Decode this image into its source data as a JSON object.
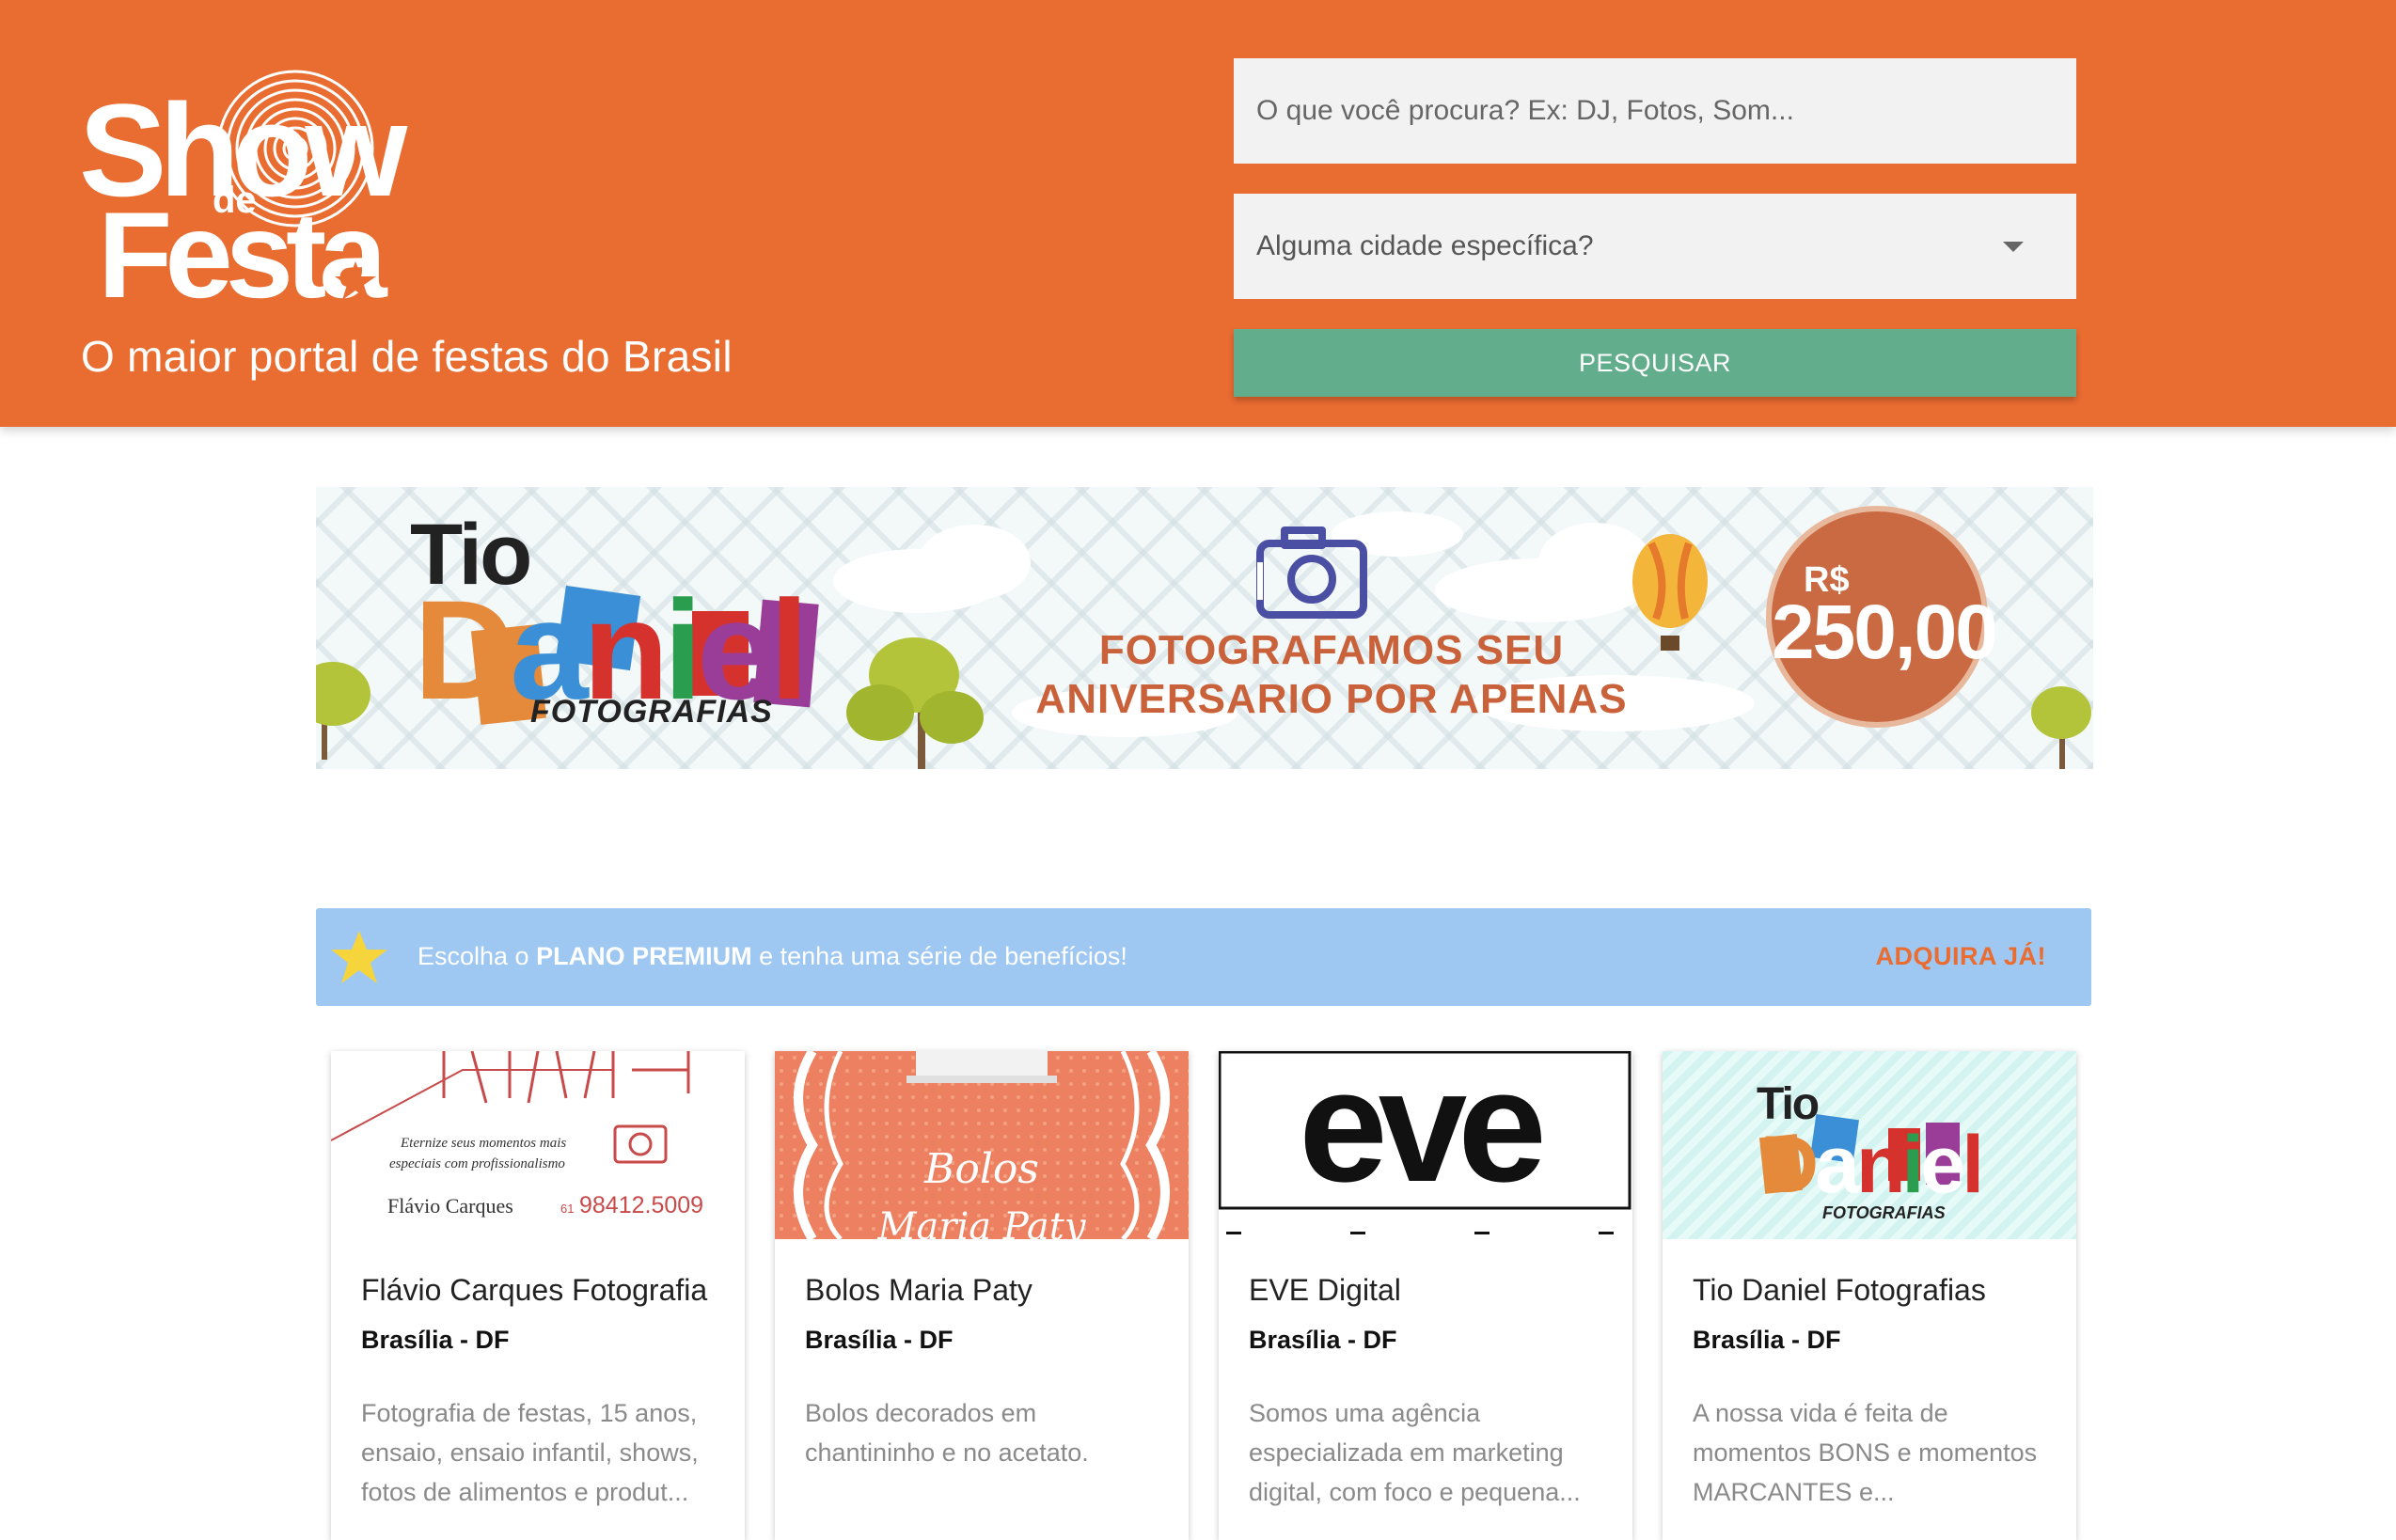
{
  "header": {
    "logo": {
      "line1": "Show",
      "line2": "de",
      "line3": "Festa"
    },
    "tagline": "O maior portal de festas do Brasil",
    "search": {
      "placeholder": "O que você procura? Ex: DJ, Fotos, Som..."
    },
    "city": {
      "placeholder": "Alguma cidade específica?"
    },
    "search_button": "PESQUISAR",
    "colors": {
      "header_bg": "#e96c31",
      "button_bg": "#62ad8b"
    }
  },
  "banner": {
    "brand_top": "Tio",
    "brand_letters": [
      "D",
      "a",
      "n",
      "i",
      "e",
      "l"
    ],
    "brand_sub": "FOTOGRAFIAS",
    "headline_line1": "FOTOGRAFAMOS SEU",
    "headline_line2": "ANIVERSARIO POR APENAS",
    "price_currency": "R$",
    "price_value": "250,00",
    "icons": [
      "camera-icon",
      "hot-air-balloon-icon",
      "tree-icon",
      "cloud-icon"
    ]
  },
  "premium": {
    "text_before": "Escolha o ",
    "text_bold": "PLANO PREMIUM",
    "text_after": " e tenha uma série de benefícios!",
    "cta": "ADQUIRA JÁ!",
    "icon": "star-icon",
    "colors": {
      "bg": "#9ec7f2",
      "cta": "#e96c31"
    }
  },
  "cards": [
    {
      "title": "Flávio Carques Fotografia",
      "city": "Brasília - DF",
      "description": "Fotografia de festas, 15 anos, ensaio, ensaio infantil, shows, fotos de alimentos e produt...",
      "image": {
        "slogan_1": "Eternize seus momentos mais",
        "slogan_2": "especiais com profissionalismo",
        "name": "Flávio Carques",
        "phone_prefix": "61",
        "phone": "98412.5009"
      }
    },
    {
      "title": "Bolos Maria Paty",
      "city": "Brasília - DF",
      "description": "Bolos decorados em chantininho e no acetato.",
      "image": {
        "line1": "Bolos",
        "line2": "Maria Paty"
      }
    },
    {
      "title": "EVE Digital",
      "city": "Brasília - DF",
      "description": "Somos uma agência especializada em marketing digital, com foco e pequena...",
      "image": {
        "logo": "eve"
      }
    },
    {
      "title": "Tio Daniel Fotografias",
      "city": "Brasília - DF",
      "description": "A nossa vida é feita de momentos BONS e momentos MARCANTES e...",
      "image": {
        "top": "Tio",
        "letters": [
          "D",
          "a",
          "n",
          "i",
          "e",
          "l"
        ],
        "sub": "FOTOGRAFIAS"
      }
    }
  ]
}
